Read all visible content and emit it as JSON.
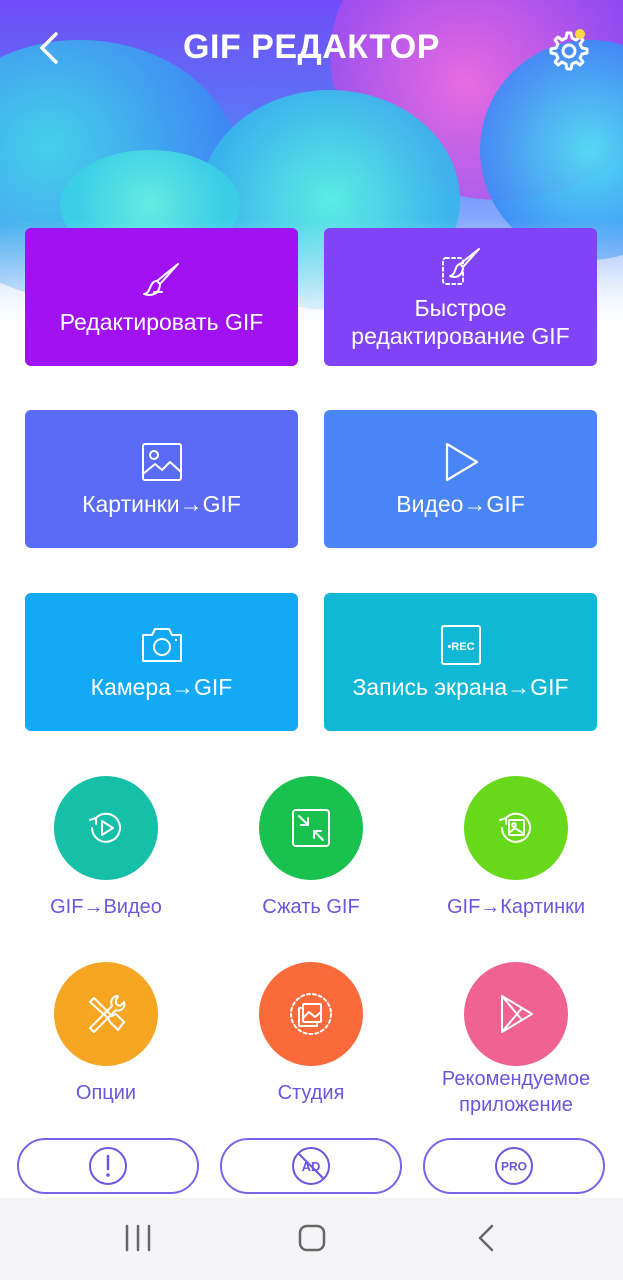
{
  "header": {
    "title": "GIF РЕДАКТОР",
    "back_icon": "chevron-left-icon",
    "settings_icon": "gear-icon",
    "notification_dot_color": "#ffd740"
  },
  "tiles": [
    {
      "label": "Редактировать GIF",
      "icon": "brush-icon",
      "color": "#a012f2"
    },
    {
      "label": "Быстрое редактирование GIF",
      "icon": "quick-brush-icon",
      "color": "#8043f5"
    },
    {
      "label": "Картинки→GIF",
      "icon": "image-icon",
      "color": "#5a6cf5"
    },
    {
      "label": "Видео→GIF",
      "icon": "play-icon",
      "color": "#4a85f6"
    },
    {
      "label": "Камера→GIF",
      "icon": "camera-icon",
      "color": "#12aaf4"
    },
    {
      "label": "Запись экрана→GIF",
      "icon": "rec-icon",
      "color": "#11b8d6"
    }
  ],
  "tools": [
    {
      "label": "GIF→Видео",
      "icon": "gif-to-video-icon",
      "color": "#16bfa7"
    },
    {
      "label": "Сжать GIF",
      "icon": "compress-icon",
      "color": "#19c24f"
    },
    {
      "label": "GIF→Картинки",
      "icon": "gif-to-image-icon",
      "color": "#67d91a"
    },
    {
      "label": "Опции",
      "icon": "tools-icon",
      "color": "#f6a623"
    },
    {
      "label": "Студия",
      "icon": "studio-icon",
      "color": "#fb6a3a"
    },
    {
      "label": "Рекомендуемое приложение",
      "icon": "play-store-icon",
      "color": "#f06292"
    }
  ],
  "bottom_buttons": [
    {
      "icon": "alert-icon"
    },
    {
      "icon": "no-ads-icon",
      "text": "AD"
    },
    {
      "icon": "pro-icon",
      "text": "PRO"
    }
  ],
  "accent_color": "#6a57e0",
  "system_nav": [
    "recents-icon",
    "home-icon",
    "back-icon"
  ]
}
